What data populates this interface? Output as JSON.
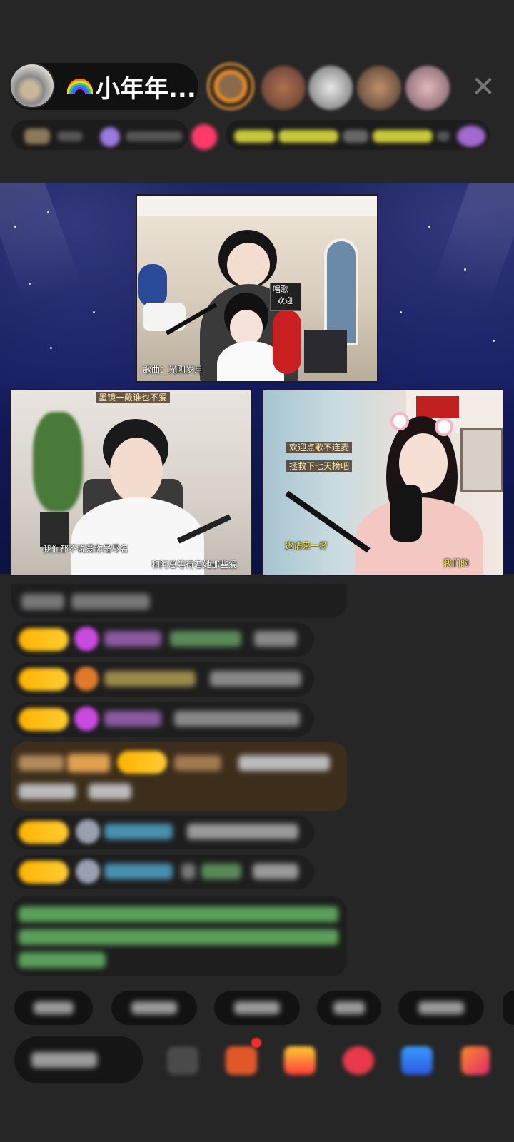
{
  "header": {
    "host_name": "小年年...",
    "close_icon": "close-icon"
  },
  "videos": {
    "top": {
      "song_caption": "歌曲：光阴岁月",
      "sign_text_1": "唱歌",
      "sign_text_2": "欢迎"
    },
    "left": {
      "top_caption": "墨镜一戴谁也不爱",
      "bottom_caption_1": "我们都不说爱你是尽名",
      "bottom_caption_2": "和阿总等待着她那些爱"
    },
    "right": {
      "caption_1": "欢迎点歌不连麦",
      "caption_2": "拯救下七天榜吧",
      "caption_3": "邀请来一杯",
      "caption_4": "我们的"
    }
  },
  "colors": {
    "badge": "#ffb300",
    "stage_bg": "#141b5e",
    "page_bg": "#262626"
  }
}
